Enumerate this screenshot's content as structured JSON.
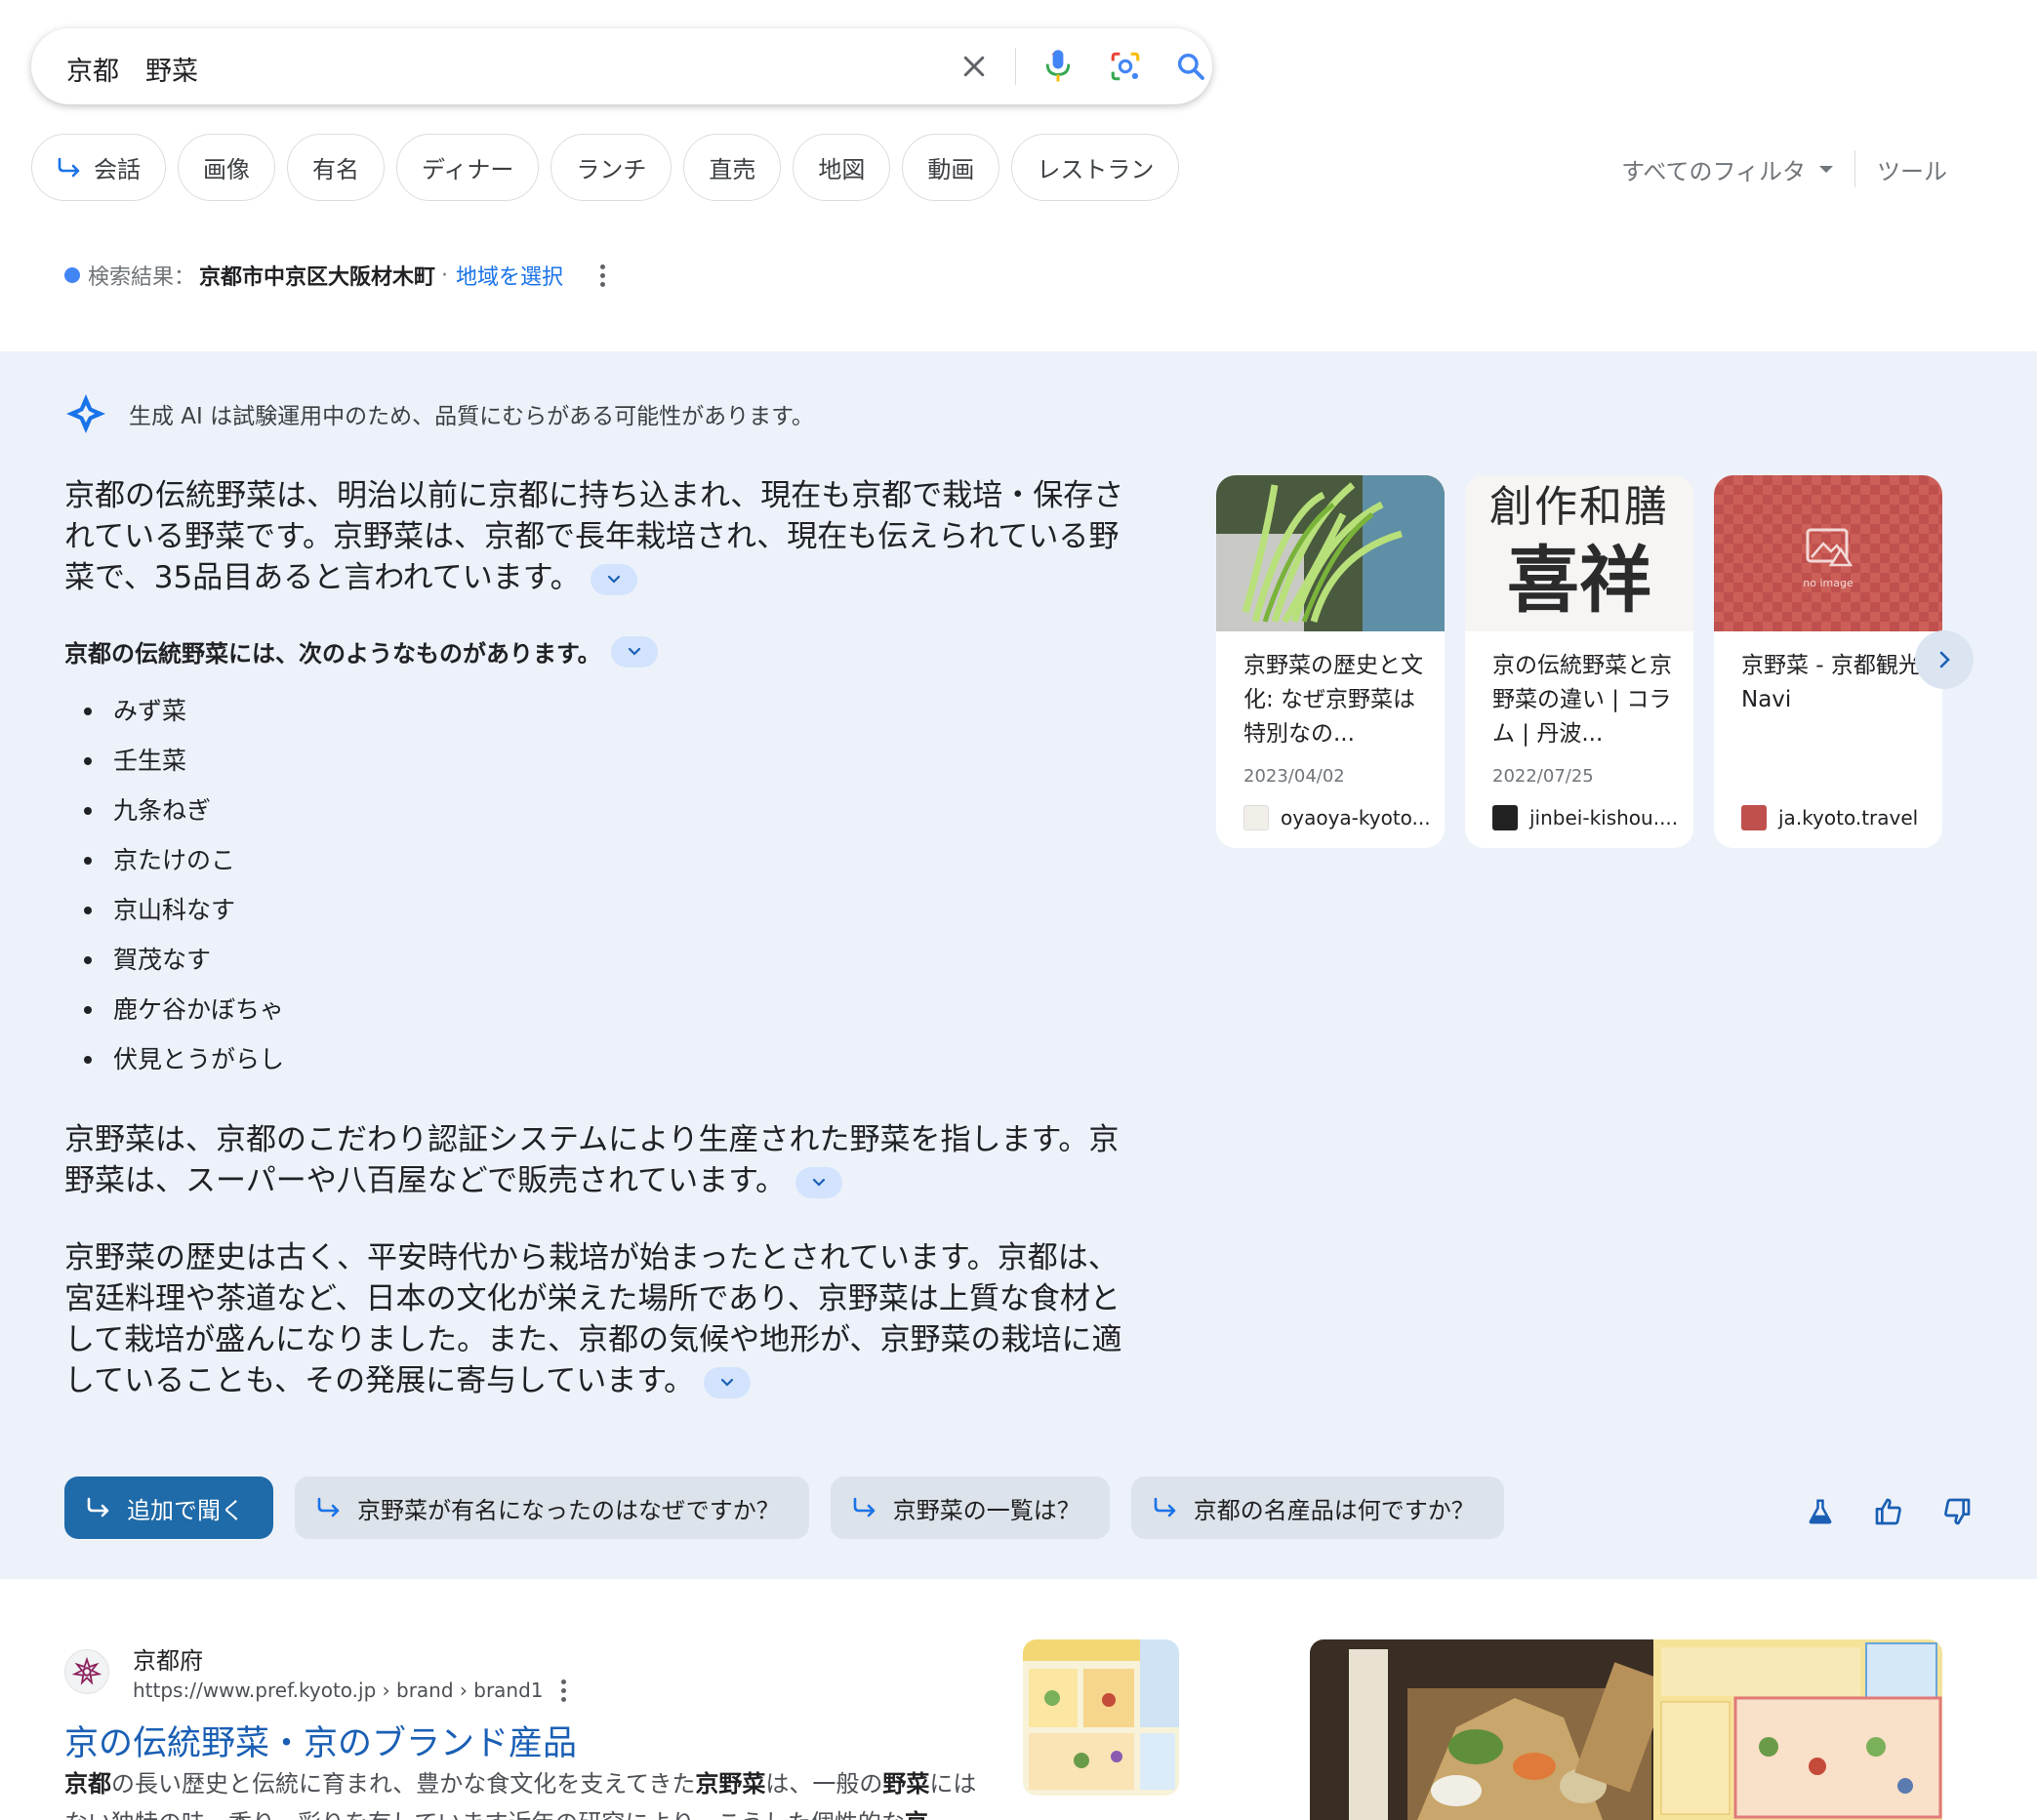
{
  "search": {
    "query": "京都　野菜",
    "clear_icon": "close-icon",
    "voice_icon": "microphone-icon",
    "lens_icon": "camera-lens-icon",
    "search_icon": "search-icon"
  },
  "chips": [
    {
      "label": "会話",
      "icon": "reply-arrow-icon"
    },
    {
      "label": "画像"
    },
    {
      "label": "有名"
    },
    {
      "label": "ディナー"
    },
    {
      "label": "ランチ"
    },
    {
      "label": "直売"
    },
    {
      "label": "地図"
    },
    {
      "label": "動画"
    },
    {
      "label": "レストラン"
    }
  ],
  "filters": {
    "all_filters": "すべてのフィルタ",
    "tools": "ツール"
  },
  "location": {
    "prefix": "検索結果：",
    "place": "京都市中京区大阪材木町",
    "separator": "·",
    "change_link": "地域を選択"
  },
  "ai_overview": {
    "disclaimer": "生成 AI は試験運用中のため、品質にむらがある可能性があります。",
    "intro": "京都の伝統野菜は、明治以前に京都に持ち込まれ、現在も京都で栽培・保存されている野菜です。京野菜は、京都で長年栽培され、現在も伝えられている野菜で、35品目あると言われています。",
    "list_heading": "京都の伝統野菜には、次のようなものがあります。",
    "vegetables": [
      "みず菜",
      "壬生菜",
      "九条ねぎ",
      "京たけのこ",
      "京山科なす",
      "賀茂なす",
      "鹿ケ谷かぼちゃ",
      "伏見とうがらし"
    ],
    "para2": "京野菜は、京都のこだわり認証システムにより生産された野菜を指します。京野菜は、スーパーや八百屋などで販売されています。",
    "para3": "京野菜の歴史は古く、平安時代から栽培が始まったとされています。京都は、宮廷料理や茶道など、日本の文化が栄えた場所であり、京野菜は上質な食材として栽培が盛んになりました。また、京都の気候や地形が、京野菜の栽培に適していることも、その発展に寄与しています。",
    "cards": [
      {
        "title": "京野菜の歴史と文化: なぜ京野菜は特別なの...",
        "date": "2023/04/02",
        "source": "oyaoya-kyoto..."
      },
      {
        "title": "京の伝統野菜と京野菜の違い | コラム | 丹波...",
        "date": "2022/07/25",
        "source": "jinbei-kishou...."
      },
      {
        "title": "京野菜 - 京都観光Navi",
        "date": "",
        "source": "ja.kyoto.travel"
      }
    ],
    "card2_thumb_line1": "創作和膳",
    "card2_thumb_line2": "喜祥",
    "card3_thumb_text": "no image",
    "followup_primary": "追加で聞く",
    "suggestions": [
      "京野菜が有名になったのはなぜですか？",
      "京野菜の一覧は？",
      "京都の名産品は何ですか？"
    ]
  },
  "result": {
    "site_name": "京都府",
    "url": "https://www.pref.kyoto.jp › brand › brand1",
    "title": "京の伝統野菜・京のブランド産品",
    "snippet_parts": [
      "京都",
      "の長い歴史と伝統に育まれ、豊かな食文化を支えてきた",
      "京野菜",
      "は、一般の",
      "野菜",
      "に",
      "はない独特の味、香り、彩りを有しています近年の研究により、こうした個性的な",
      "京"
    ]
  },
  "colors": {
    "accent_blue": "#1a73e8",
    "ai_panel_bg": "#edf2fa",
    "primary_button": "#1f6aa8"
  }
}
